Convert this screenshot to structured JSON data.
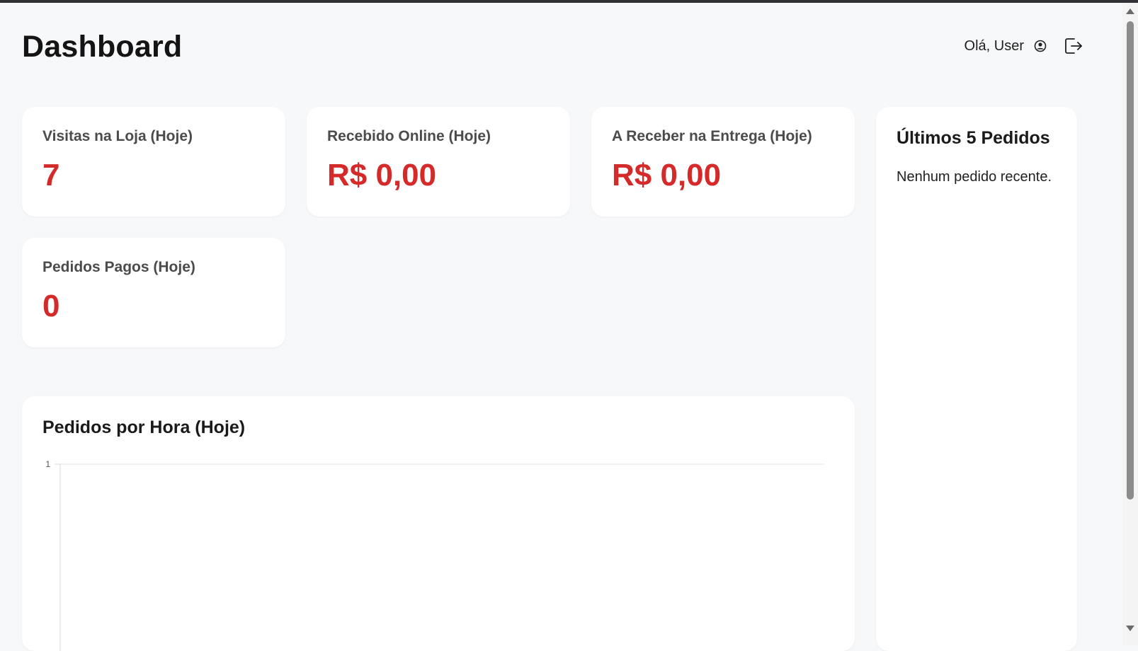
{
  "header": {
    "title": "Dashboard",
    "greeting": "Olá, User",
    "user_icon": "user-circle-icon",
    "logout_icon": "logout-icon"
  },
  "stats": [
    {
      "label": "Visitas na Loja (Hoje)",
      "value": "7"
    },
    {
      "label": "Recebido Online (Hoje)",
      "value": "R$ 0,00"
    },
    {
      "label": "A Receber na Entrega (Hoje)",
      "value": "R$ 0,00"
    },
    {
      "label": "Pedidos Pagos (Hoje)",
      "value": "0"
    }
  ],
  "colors": {
    "accent": "#d42a2a",
    "background": "#f7f8fa",
    "card": "#ffffff"
  },
  "chart_data": {
    "type": "line",
    "title": "Pedidos por Hora (Hoje)",
    "xlabel": "",
    "ylabel": "",
    "y_ticks": [
      "1"
    ],
    "ylim": [
      0,
      1
    ],
    "series": [],
    "grid": true
  },
  "recent_orders": {
    "title": "Últimos 5 Pedidos",
    "empty_message": "Nenhum pedido recente."
  }
}
